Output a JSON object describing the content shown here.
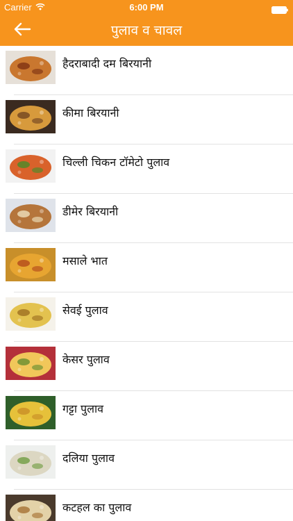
{
  "status_bar": {
    "carrier": "Carrier",
    "time": "6:00 PM"
  },
  "nav": {
    "title": "पुलाव व चावल",
    "back_icon": "arrow-left-icon"
  },
  "colors": {
    "header": "#f7941d",
    "divider": "#e2e2e2",
    "text": "#111111"
  },
  "recipes": [
    {
      "title": "हैदराबादी दम बिरयानी",
      "thumb": {
        "plate": "#e6e0d8",
        "rice": "#c9772f",
        "accent": "#7a2e12"
      }
    },
    {
      "title": "कीमा बिरयानी",
      "thumb": {
        "plate": "#3a2a20",
        "rice": "#d79a3c",
        "accent": "#6b3f1f"
      }
    },
    {
      "title": "चिल्ली चिकन टॉमेटो पुलाव",
      "thumb": {
        "plate": "#f2f2f2",
        "rice": "#d9622b",
        "accent": "#3f8f2a"
      }
    },
    {
      "title": "डीमेर बिरयानी",
      "thumb": {
        "plate": "#dfe3ea",
        "rice": "#b5753b",
        "accent": "#f1e7c6"
      }
    },
    {
      "title": "मसाले भात",
      "thumb": {
        "plate": "#c88f2a",
        "rice": "#e7a531",
        "accent": "#b0441a"
      }
    },
    {
      "title": "सेवई पुलाव",
      "thumb": {
        "plate": "#f5f2ea",
        "rice": "#e3c24f",
        "accent": "#9a6a1e"
      }
    },
    {
      "title": "केसर पुलाव",
      "thumb": {
        "plate": "#b4303a",
        "rice": "#f1c75a",
        "accent": "#5d8a2e"
      }
    },
    {
      "title": "गट्टा पुलाव",
      "thumb": {
        "plate": "#2f5f2a",
        "rice": "#e6c13a",
        "accent": "#c78a25"
      }
    },
    {
      "title": "दलिया पुलाव",
      "thumb": {
        "plate": "#eef0ee",
        "rice": "#dcd7c2",
        "accent": "#6a9a3a"
      }
    },
    {
      "title": "कटहल का पुलाव",
      "thumb": {
        "plate": "#4a3a2c",
        "rice": "#e3d2a8",
        "accent": "#a26b2c"
      }
    }
  ]
}
